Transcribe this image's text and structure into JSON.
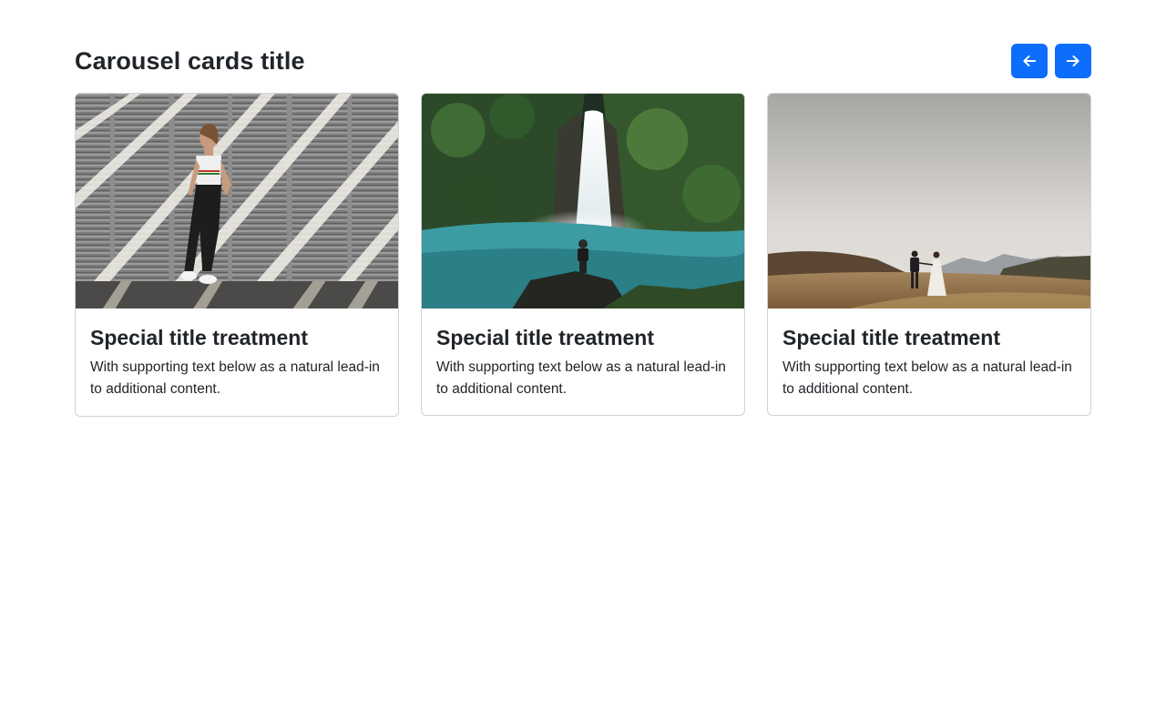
{
  "carousel": {
    "title": "Carousel cards title",
    "prev_icon": "arrow-left-icon",
    "next_icon": "arrow-right-icon",
    "accent_color": "#0d6efd"
  },
  "cards": [
    {
      "image": "woman-against-shuttered-wall-photo",
      "title": "Special title treatment",
      "text": "With supporting text below as a natural lead-in to additional content."
    },
    {
      "image": "waterfall-with-man-on-rock-photo",
      "title": "Special title treatment",
      "text": "With supporting text below as a natural lead-in to additional content."
    },
    {
      "image": "couple-walking-in-hills-photo",
      "title": "Special title treatment",
      "text": "With supporting text below as a natural lead-in to additional content."
    }
  ]
}
